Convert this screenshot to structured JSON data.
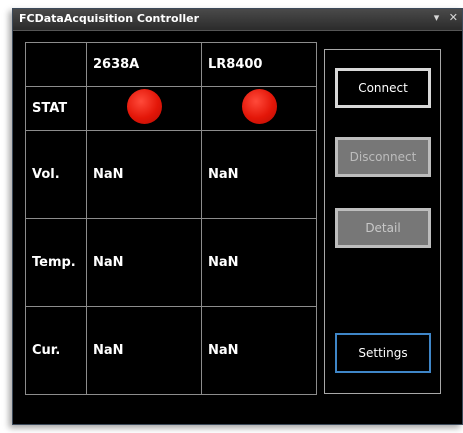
{
  "window": {
    "title": "FCDataAcquisition Controller",
    "menu_icon": "▾",
    "close_icon": "✕"
  },
  "table": {
    "headers": [
      "",
      "2638A",
      "LR8400"
    ],
    "stat_label": "STAT",
    "stat_colors": [
      "#e31608",
      "#e31608"
    ],
    "rows": [
      {
        "label": "Vol.",
        "values": [
          "NaN",
          "NaN"
        ]
      },
      {
        "label": "Temp.",
        "values": [
          "NaN",
          "NaN"
        ]
      },
      {
        "label": "Cur.",
        "values": [
          "NaN",
          "NaN"
        ]
      }
    ]
  },
  "buttons": {
    "connect": "Connect",
    "disconnect": "Disconnect",
    "detail": "Detail",
    "settings": "Settings"
  },
  "colors": {
    "background": "#000000",
    "status_off": "#e31608",
    "settings_focus_border": "#3f86c8"
  }
}
